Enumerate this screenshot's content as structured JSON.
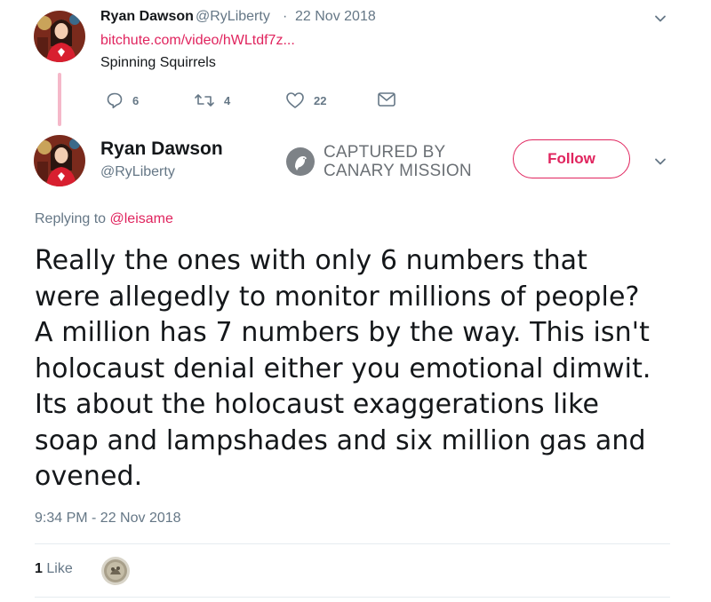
{
  "parent_tweet": {
    "author_name": "Ryan Dawson",
    "author_handle": "@RyLiberty",
    "separator": "·",
    "date": "22 Nov 2018",
    "link_text": "bitchute.com/video/hWLtdf7z...",
    "text": "Spinning Squirrels",
    "replies_count": "6",
    "retweets_count": "4",
    "likes_count": "22"
  },
  "main_tweet": {
    "author_name": "Ryan Dawson",
    "author_handle": "@RyLiberty",
    "follow_label": "Follow",
    "replying_prefix": "Replying to",
    "replying_to": "@leisame",
    "text": "Really the ones with only 6 numbers that\nwere allegedly to monitor  millions of people?\nA million has 7 numbers by the way. This isn't\nholocaust denial either you emotional dimwit.\nIts about the holocaust  exaggerations like\nsoap and lampshades and six million gas and\novened.",
    "timestamp": "9:34 PM - 22 Nov 2018",
    "likes_count": "1",
    "likes_label": "Like"
  },
  "watermark": {
    "line1": "CAPTURED BY",
    "line2": "CANARY MISSION"
  },
  "colors": {
    "accent": "#e0245e",
    "muted": "#657786",
    "thread_line": "#f5b8c9"
  },
  "icons": [
    "reply-icon",
    "retweet-icon",
    "like-icon",
    "message-icon",
    "chevron-down-icon",
    "canary-logo-icon"
  ]
}
